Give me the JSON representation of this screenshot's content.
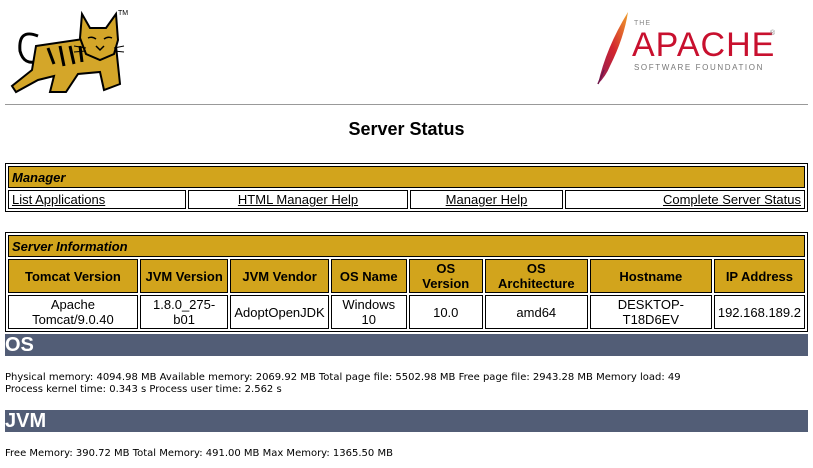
{
  "header": {
    "tm_mark": "TM",
    "apache_the": "THE",
    "apache_word": "APACHE",
    "apache_reg": "®",
    "apache_sub": "SOFTWARE FOUNDATION"
  },
  "page_title": "Server Status",
  "manager": {
    "title": "Manager",
    "links": [
      "List Applications",
      "HTML Manager Help",
      "Manager Help",
      "Complete Server Status"
    ]
  },
  "server_info": {
    "title": "Server Information",
    "columns": [
      "Tomcat Version",
      "JVM Version",
      "JVM Vendor",
      "OS Name",
      "OS Version",
      "OS Architecture",
      "Hostname",
      "IP Address"
    ],
    "values": [
      "Apache Tomcat/9.0.40",
      "1.8.0_275-b01",
      "AdoptOpenJDK",
      "Windows 10",
      "10.0",
      "amd64",
      "DESKTOP-T18D6EV",
      "192.168.189.2"
    ]
  },
  "os": {
    "title": "OS",
    "line1": "Physical memory: 4094.98 MB Available memory: 2069.92 MB Total page file: 5502.98 MB Free page file: 2943.28 MB Memory load: 49",
    "line2": "Process kernel time: 0.343 s Process user time: 2.562 s"
  },
  "jvm": {
    "title": "JVM",
    "line1": "Free Memory: 390.72 MB Total Memory: 491.00 MB Max Memory: 1365.50 MB"
  },
  "colors": {
    "section_bg": "#d2a41c",
    "band_bg": "#525d76",
    "apache_red": "#c8102e"
  }
}
